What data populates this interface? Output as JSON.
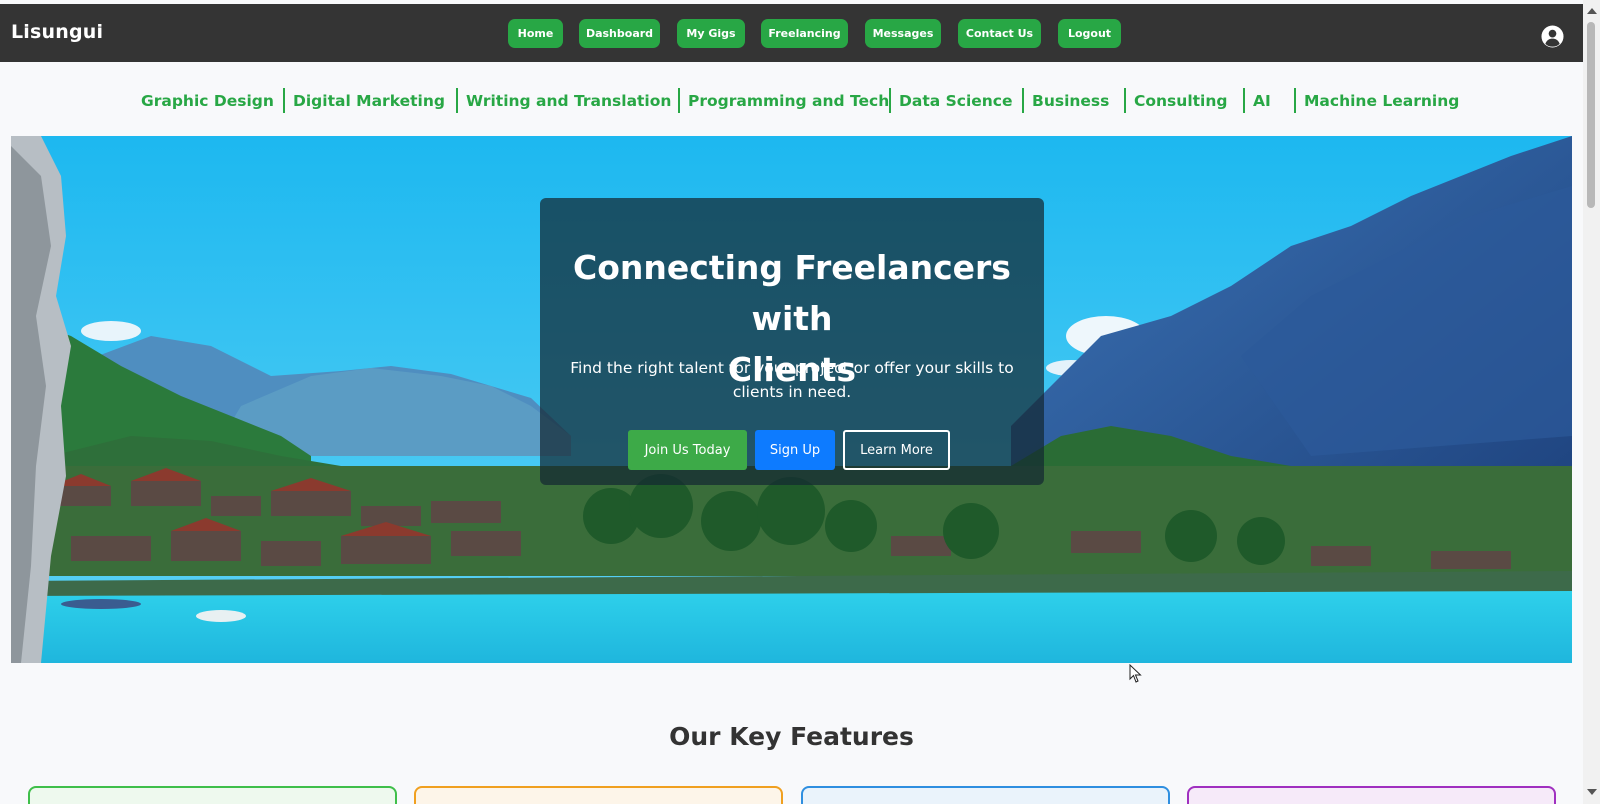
{
  "header": {
    "brand": "Lisungui",
    "nav": [
      {
        "label": "Home"
      },
      {
        "label": "Dashboard"
      },
      {
        "label": "My Gigs"
      },
      {
        "label": "Freelancing"
      },
      {
        "label": "Messages"
      },
      {
        "label": "Contact Us"
      },
      {
        "label": "Logout"
      }
    ],
    "user_icon": "user-circle-icon"
  },
  "categories": [
    "Graphic Design",
    "Digital Marketing",
    "Writing and Translation",
    "Programming and Tech",
    "Data Science",
    "Business",
    "Consulting",
    "AI",
    "Machine Learning"
  ],
  "hero": {
    "title_line1": "Connecting Freelancers with",
    "title_line2": "Clients",
    "subtitle_line1": "Find the right talent for your project or offer your skills to",
    "subtitle_line2": "clients in need.",
    "buttons": {
      "join": "Join Us Today",
      "signup": "Sign Up",
      "learn": "Learn More"
    }
  },
  "features": {
    "title": "Our Key Features",
    "card_colors": [
      "#3fbf4a",
      "#f0a020",
      "#2f8fe0",
      "#a030c0"
    ]
  },
  "colors": {
    "accent": "#28a745",
    "topbar": "#343434",
    "signup": "#0d7bff"
  }
}
